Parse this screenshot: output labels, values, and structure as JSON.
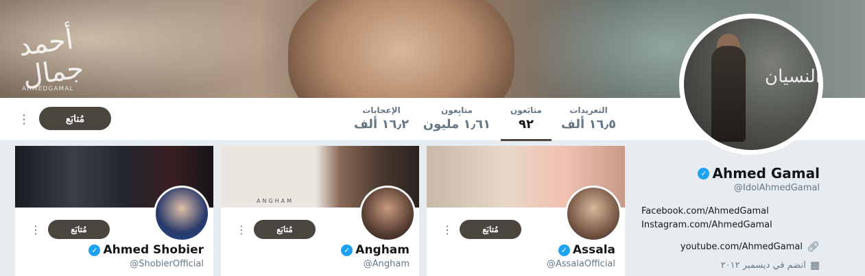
{
  "banner": {
    "logo_text": "AHMEDGAMAL"
  },
  "nav": {
    "follow_label": "مُتابَع",
    "stats": [
      {
        "label": "التغريدات",
        "value": "١٦٫٥ ألف"
      },
      {
        "label": "متابَعون",
        "value": "٩٢"
      },
      {
        "label": "متابِعون",
        "value": "١٫٦١ مليون"
      },
      {
        "label": "الإعجابات",
        "value": "١٦٫٢ ألف"
      }
    ]
  },
  "profile": {
    "name": "Ahmed Gamal",
    "handle": "@IdolAhmedGamal",
    "bio_line1": "Facebook.com/AhmedGamal",
    "bio_line2": "Instagram.com/AhmedGamal",
    "link": "youtube.com/AhmedGamal",
    "joined": "انضم في ديسمبر ٢٠١٢"
  },
  "cards": [
    {
      "name": "Assala",
      "handle": "@AssalaOfficial",
      "follow_label": "مُتابَع"
    },
    {
      "name": "Angham",
      "handle": "@Angham",
      "follow_label": "مُتابَع"
    },
    {
      "name": "Ahmed Shobier",
      "handle": "@ShobierOfficial",
      "follow_label": "مُتابَع"
    }
  ],
  "card_banner_texts": {
    "angham_banner": "ANGHAM"
  },
  "colors": {
    "accent": "#4b4540",
    "verified": "#1da1f2",
    "muted": "#657786"
  },
  "icons": {
    "more": "more-vertical-icon",
    "verified": "verified-badge-icon",
    "link": "link-icon",
    "calendar": "calendar-icon"
  }
}
